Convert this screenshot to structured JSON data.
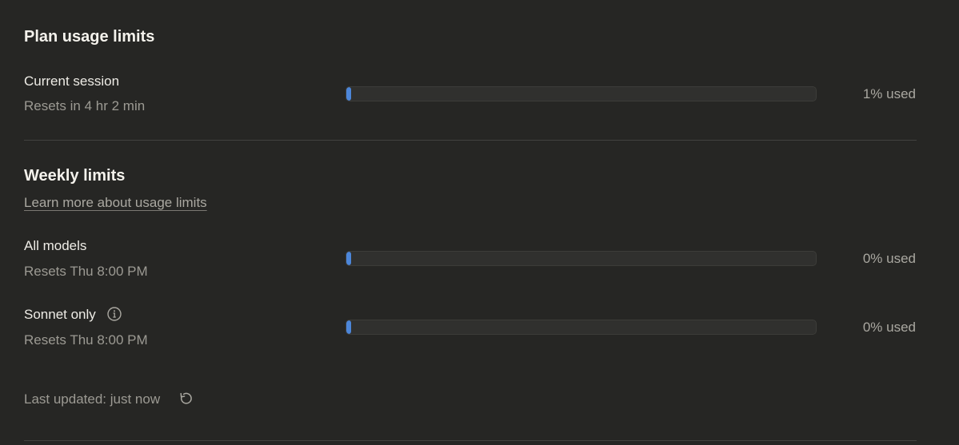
{
  "plan": {
    "title": "Plan usage limits",
    "current_session": {
      "label": "Current session",
      "reset": "Resets in 4 hr 2 min",
      "usage_text": "1% used",
      "fraction": 0.01
    }
  },
  "weekly": {
    "title": "Weekly limits",
    "learn_more": "Learn more about usage limits",
    "all_models": {
      "label": "All models",
      "reset": "Resets Thu 8:00 PM",
      "usage_text": "0% used",
      "fraction": 0.0
    },
    "sonnet_only": {
      "label": "Sonnet only",
      "reset": "Resets Thu 8:00 PM",
      "usage_text": "0% used",
      "fraction": 0.0,
      "info_icon": "info-icon"
    }
  },
  "footer": {
    "last_updated": "Last updated: just now",
    "refresh_icon": "refresh-icon"
  },
  "colors": {
    "background": "#262624",
    "bar_fill": "#4c86d9",
    "bar_track": "#30302e"
  }
}
